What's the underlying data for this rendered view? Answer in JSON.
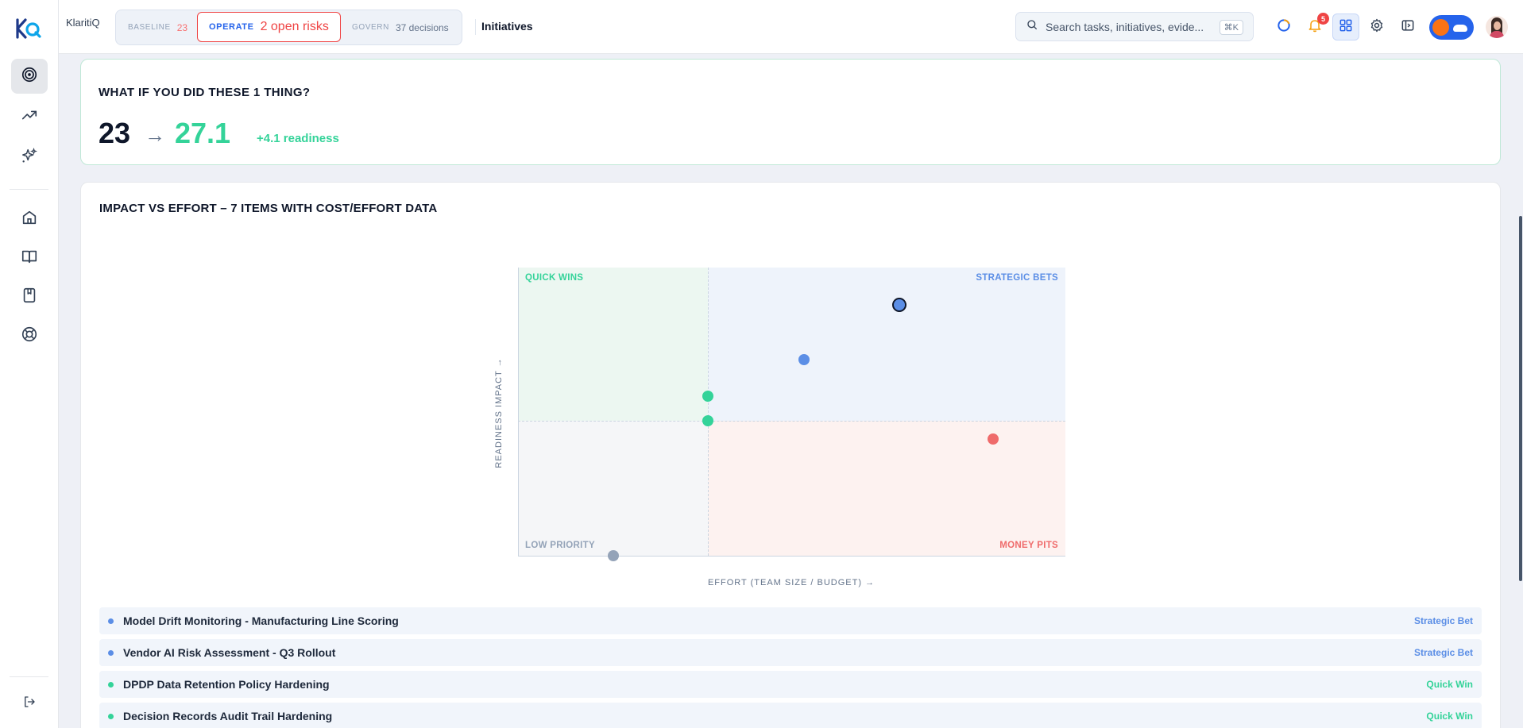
{
  "app": {
    "name": "KlaritiQ"
  },
  "modes": {
    "baseline": {
      "label": "BASELINE",
      "value": "23"
    },
    "operate": {
      "label": "OPERATE",
      "value": "2 open risks"
    },
    "govern": {
      "label": "GOVERN",
      "value": "37 decisions"
    }
  },
  "page_title": "Initiatives",
  "search": {
    "placeholder": "Search tasks, initiatives, evide...",
    "shortcut": "⌘K"
  },
  "notifications": {
    "count": "5"
  },
  "icons": {
    "sidebar": [
      "target-icon",
      "trending-up-icon",
      "sparkles-icon",
      "home-icon",
      "book-open-icon",
      "bookmark-book-icon",
      "lifebuoy-icon",
      "logout-icon"
    ],
    "topbar": [
      "status-ring-icon",
      "bell-icon",
      "grid-icon",
      "gear-icon",
      "panel-icon"
    ]
  },
  "colors": {
    "accent": "#2563eb",
    "quick_win": "#34d399",
    "strategic_bet": "#5b8ee6",
    "money_pit": "#ef6b6b",
    "low_priority": "#94a3b8",
    "risk": "#ef4444"
  },
  "whatif": {
    "title": "WHAT IF YOU DID THESE 1 THING?",
    "from": "23",
    "arrow": "→",
    "to": "27.1",
    "delta": "+4.1 readiness"
  },
  "impact": {
    "title": "IMPACT VS EFFORT – 7 ITEMS WITH COST/EFFORT DATA",
    "quadrants": {
      "quick_wins": "QUICK WINS",
      "strategic_bets": "STRATEGIC BETS",
      "low_priority": "LOW PRIORITY",
      "money_pits": "MONEY PITS"
    },
    "ylabel": "READINESS IMPACT →",
    "xlabel": "EFFORT (TEAM SIZE / BUDGET) →"
  },
  "chart_data": {
    "type": "scatter",
    "title": "IMPACT VS EFFORT – 7 ITEMS WITH COST/EFFORT DATA",
    "xlabel": "EFFORT (TEAM SIZE / BUDGET) →",
    "ylabel": "READINESS IMPACT →",
    "xlim": [
      0,
      1
    ],
    "ylim": [
      0,
      1
    ],
    "points": [
      {
        "x": 0.697,
        "y": 0.871,
        "category": "Strategic Bet",
        "highlighted": true
      },
      {
        "x": 0.522,
        "y": 0.681,
        "category": "Strategic Bet"
      },
      {
        "x": 0.347,
        "y": 0.554,
        "category": "Quick Win"
      },
      {
        "x": 0.347,
        "y": 0.468,
        "category": "Quick Win"
      },
      {
        "x": 0.868,
        "y": 0.405,
        "category": "Money Pit"
      },
      {
        "x": 0.174,
        "y": 0.0,
        "category": "Low Priority"
      }
    ]
  },
  "items": [
    {
      "name": "Model Drift Monitoring - Manufacturing Line Scoring",
      "tag": "Strategic Bet",
      "color": "#5b8ee6"
    },
    {
      "name": "Vendor AI Risk Assessment - Q3 Rollout",
      "tag": "Strategic Bet",
      "color": "#5b8ee6"
    },
    {
      "name": "DPDP Data Retention Policy Hardening",
      "tag": "Quick Win",
      "color": "#34d399"
    },
    {
      "name": "Decision Records Audit Trail Hardening",
      "tag": "Quick Win",
      "color": "#34d399"
    }
  ]
}
